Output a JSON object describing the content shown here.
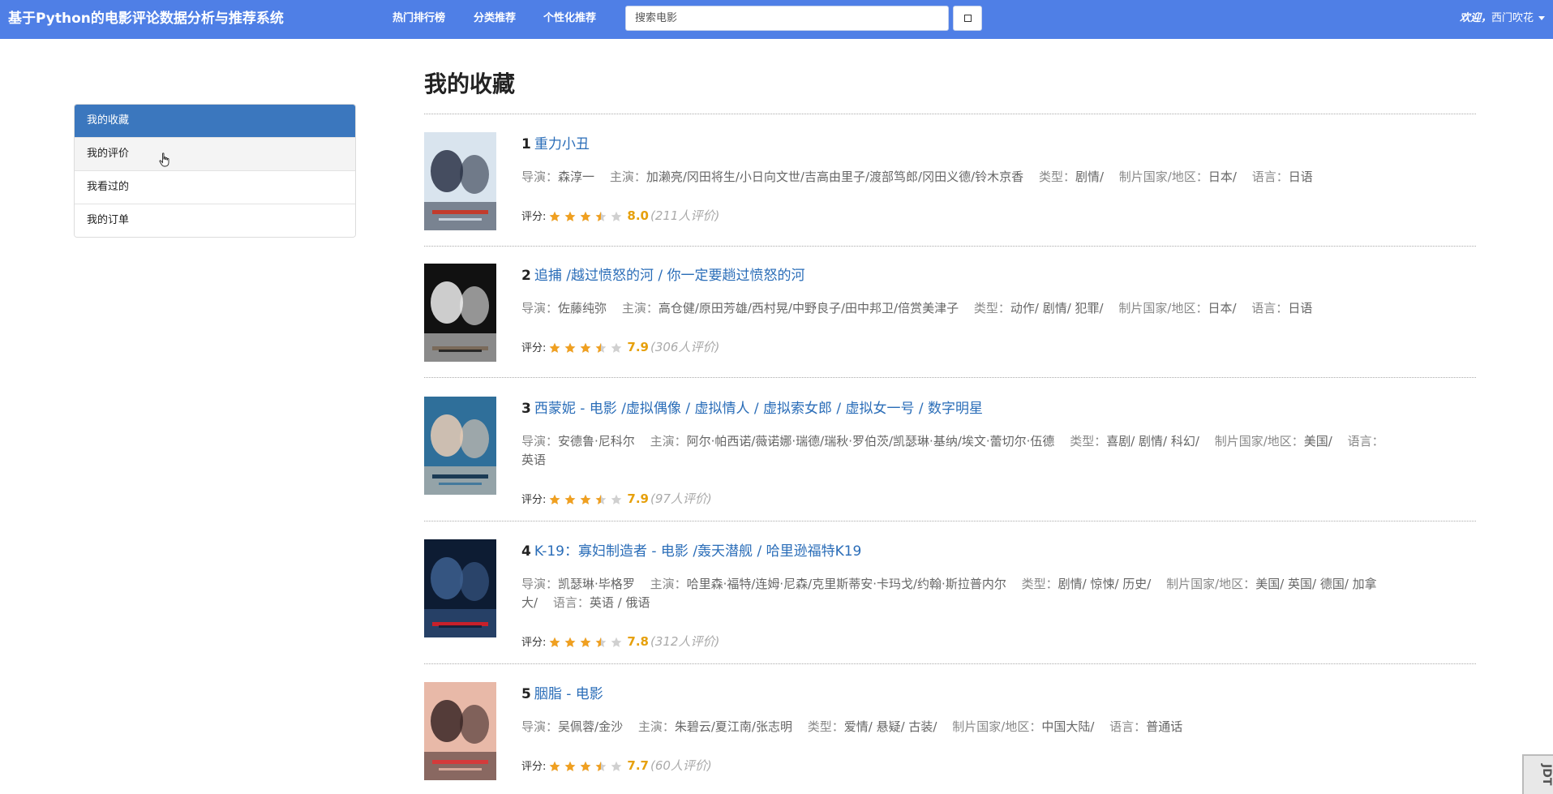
{
  "header": {
    "brand": "基于Python的电影评论数据分析与推荐系统",
    "nav": [
      "热门排行榜",
      "分类推荐",
      "个性化推荐"
    ],
    "search_placeholder": "搜索电影",
    "welcome_prefix": "欢迎，",
    "username": "西门吹花"
  },
  "sidebar": {
    "items": [
      {
        "label": "我的收藏",
        "state": "active"
      },
      {
        "label": "我的评价",
        "state": "hover"
      },
      {
        "label": "我看过的",
        "state": "normal"
      },
      {
        "label": "我的订单",
        "state": "normal"
      }
    ]
  },
  "main": {
    "title": "我的收藏",
    "labels": {
      "director": "导演：",
      "actors": "主演：",
      "genre": "类型：",
      "region": "制片国家/地区：",
      "language": "语言：",
      "rating": "评分:"
    },
    "movies": [
      {
        "rank": "1",
        "title": "重力小丑",
        "director": "森淳一",
        "actors": "加濑亮/冈田将生/小日向文世/吉高由里子/渡部笃郎/冈田义德/铃木京香",
        "genre": "剧情/",
        "region": "日本/",
        "language": "日语",
        "score": "8.0",
        "stars": 3.5,
        "votes": "(211人评价)",
        "poster_colors": [
          "#d9e4ee",
          "#2a3346",
          "#c23b2d"
        ]
      },
      {
        "rank": "2",
        "title": "追捕 /越过愤怒的河 / 你一定要趟过愤怒的河",
        "director": "佐藤纯弥",
        "actors": "高仓健/原田芳雄/西村晃/中野良子/田中邦卫/倍赏美津子",
        "genre": "动作/ 剧情/ 犯罪/",
        "region": "日本/",
        "language": "日语",
        "score": "7.9",
        "stars": 3.5,
        "votes": "(306人评价)",
        "poster_colors": [
          "#111111",
          "#efefef",
          "#7a6a5a"
        ]
      },
      {
        "rank": "3",
        "title": "西蒙妮 - 电影 /虚拟偶像 / 虚拟情人 / 虚拟索女郎 / 虚拟女一号 / 数字明星",
        "director": "安德鲁·尼科尔",
        "actors": "阿尔·帕西诺/薇诺娜·瑞德/瑞秋·罗伯茨/凯瑟琳·基纳/埃文·蕾切尔·伍德",
        "genre": "喜剧/ 剧情/ 科幻/",
        "region": "美国/",
        "language": "英语",
        "score": "7.9",
        "stars": 3.5,
        "votes": "(97人评价)",
        "poster_colors": [
          "#2f6f9a",
          "#e8cdb5",
          "#1b3b55"
        ]
      },
      {
        "rank": "4",
        "title": "K-19：寡妇制造者 - 电影 /轰天潜舰 / 哈里逊福特K19",
        "director": "凯瑟琳·毕格罗",
        "actors": "哈里森·福特/连姆·尼森/克里斯蒂安·卡玛戈/约翰·斯拉普内尔",
        "genre": "剧情/ 惊悚/ 历史/",
        "region": "美国/ 英国/ 德国/ 加拿大/",
        "language": "英语 / 俄语",
        "score": "7.8",
        "stars": 3.5,
        "votes": "(312人评价)",
        "poster_colors": [
          "#0d1c33",
          "#3d5f8f",
          "#c8202a"
        ]
      },
      {
        "rank": "5",
        "title": "胭脂 - 电影",
        "director": "吴佩蓉/金沙",
        "actors": "朱碧云/夏江南/张志明",
        "genre": "爱情/ 悬疑/ 古装/",
        "region": "中国大陆/",
        "language": "普通话",
        "score": "7.7",
        "stars": 3.5,
        "votes": "(60人评价)",
        "poster_colors": [
          "#e8b9a8",
          "#3a2626",
          "#d43b3b"
        ]
      }
    ]
  },
  "colors": {
    "navbar": "#4f7fe6",
    "sidebar_active": "#3b77be",
    "link": "#2a6db8",
    "star": "#f0a020",
    "score": "#e6a00c"
  },
  "corner_label": "JDT"
}
